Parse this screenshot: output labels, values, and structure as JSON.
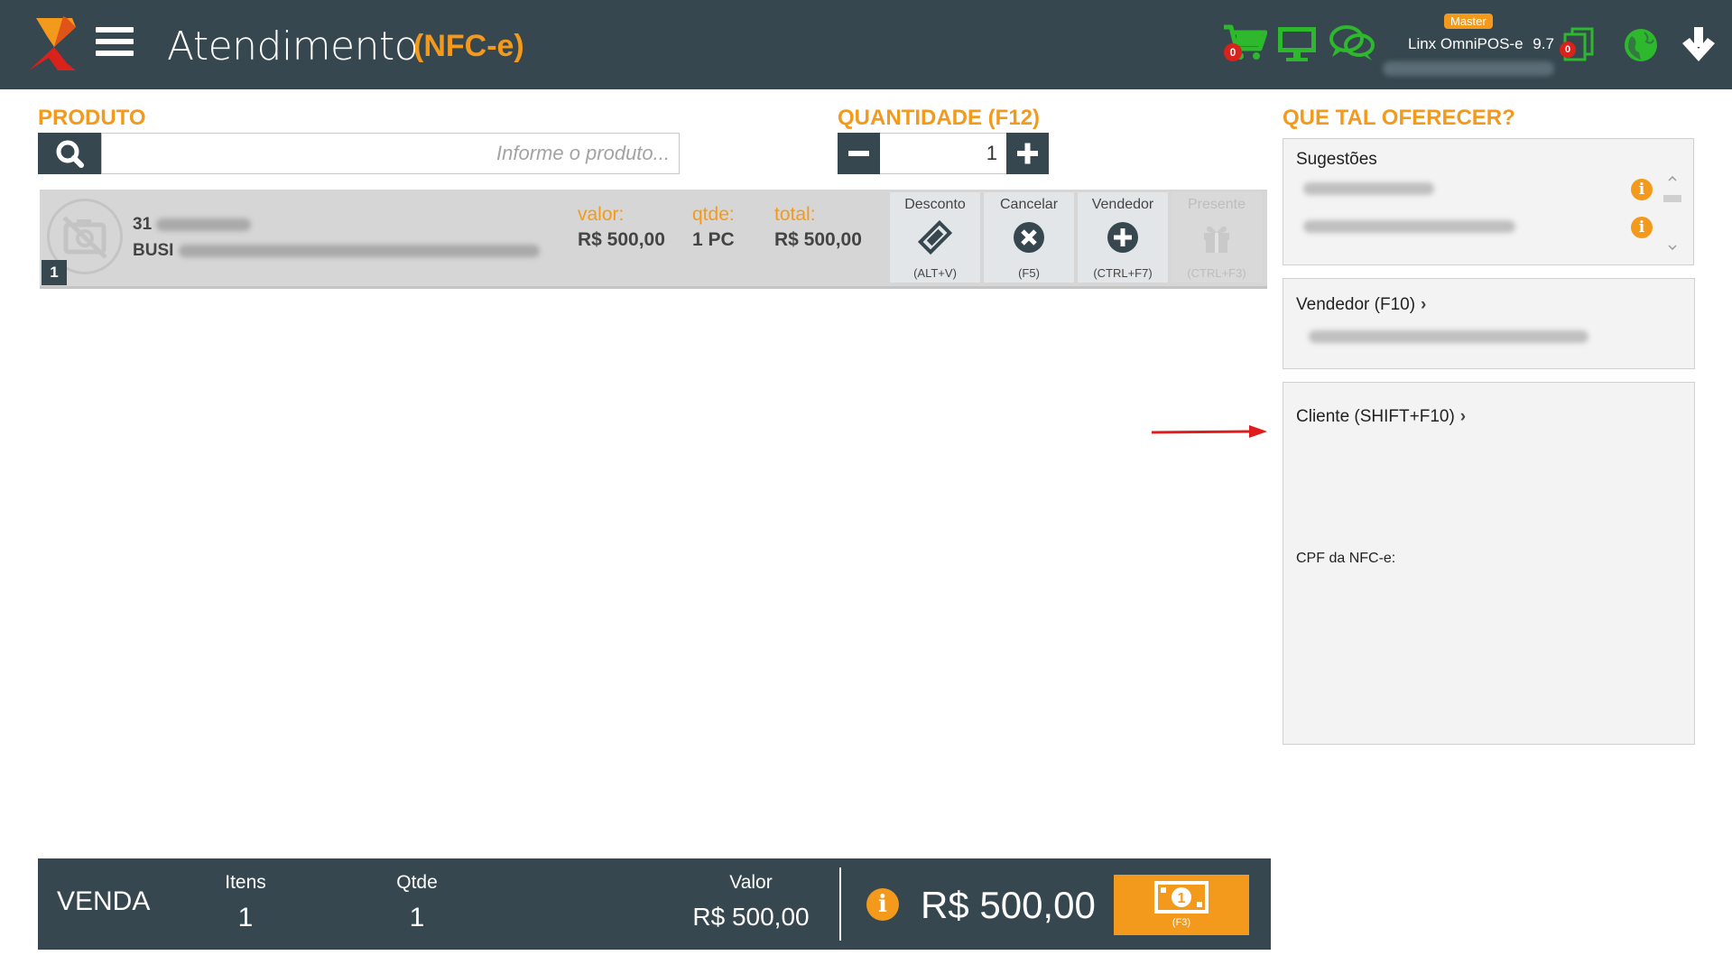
{
  "header": {
    "title": "Atendimento",
    "subtitle": "(NFC-e)",
    "cart_count": "0",
    "master_badge": "Master",
    "app_name": "Linx OmniPOS-e",
    "app_version": "9.7",
    "pending_count": "0"
  },
  "product": {
    "heading": "PRODUTO",
    "search_placeholder": "Informe o produto..."
  },
  "quantity": {
    "heading": "QUANTIDADE (F12)",
    "value": "1",
    "minus": "−",
    "plus": "+"
  },
  "item": {
    "number": "1",
    "code": "31",
    "description": "BUSI",
    "valor_label": "valor:",
    "valor": "R$ 500,00",
    "qtde_label": "qtde:",
    "qtde": "1 PC",
    "total_label": "total:",
    "total": "R$ 500,00",
    "actions": [
      {
        "label": "Desconto",
        "key": "(ALT+V)"
      },
      {
        "label": "Cancelar",
        "key": "(F5)"
      },
      {
        "label": "Vendedor",
        "key": "(CTRL+F7)"
      },
      {
        "label": "Presente",
        "key": "(CTRL+F3)"
      }
    ]
  },
  "offer": {
    "heading": "QUE TAL OFERECER?",
    "suggestions_title": "Sugestões",
    "seller_title": "Vendedor (F10)",
    "client_title": "Cliente (SHIFT+F10)",
    "cpf_label": "CPF da NFC-e:"
  },
  "sale": {
    "label": "VENDA",
    "items_label": "Itens",
    "items": "1",
    "qty_label": "Qtde",
    "qty": "1",
    "value_label": "Valor",
    "value": "R$ 500,00",
    "total": "R$ 500,00",
    "pay_key": "(F3)"
  },
  "colors": {
    "bar": "#36474f",
    "accent": "#f39a1d",
    "green": "#2eb82e",
    "red": "#d9221c"
  }
}
